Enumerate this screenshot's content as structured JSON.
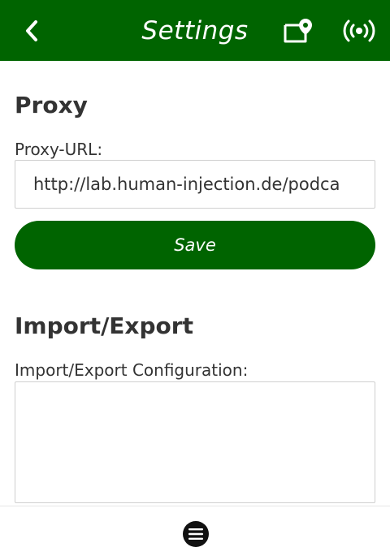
{
  "header": {
    "title": "Settings",
    "back_icon": "chevron-left-icon",
    "card_icon": "card-pin-icon",
    "signal_icon": "broadcast-icon",
    "background_color": "#006400"
  },
  "proxy": {
    "heading": "Proxy",
    "url_label": "Proxy-URL:",
    "url_value": "http://lab.human-injection.de/podca",
    "save_label": "Save"
  },
  "import_export": {
    "heading": "Import/Export",
    "config_label": "Import/Export Configuration:",
    "config_value": ""
  },
  "footer": {
    "menu_icon": "hamburger-menu-icon"
  }
}
